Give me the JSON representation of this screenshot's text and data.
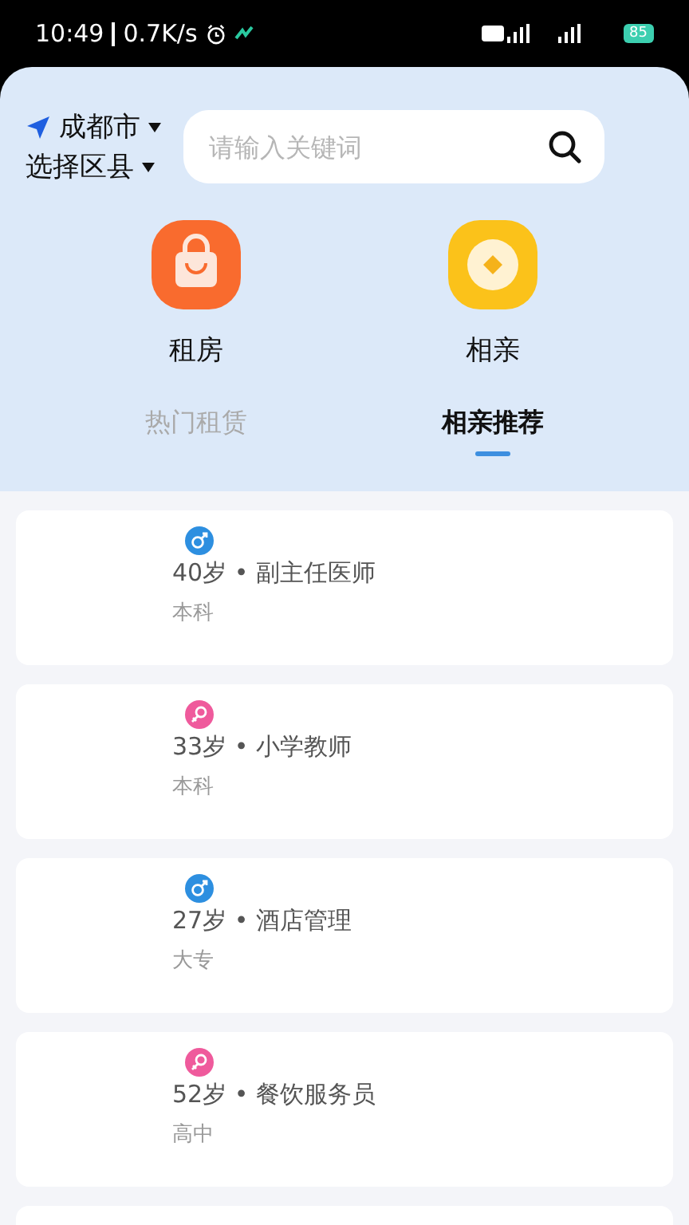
{
  "status_bar": {
    "time": "10:49",
    "speed": "0.7K/s",
    "battery": "85"
  },
  "location": {
    "city": "成都市",
    "district": "选择区县"
  },
  "search": {
    "placeholder": "请输入关键词"
  },
  "shortcuts": [
    {
      "label": "租房",
      "kind": "bag"
    },
    {
      "label": "相亲",
      "kind": "coin"
    }
  ],
  "tabs": [
    {
      "label": "热门租赁",
      "selected": false
    },
    {
      "label": "相亲推荐",
      "selected": true
    }
  ],
  "profiles": [
    {
      "kind": "male",
      "title": "40岁 • 副主任医师",
      "education": "本科"
    },
    {
      "kind": "female",
      "title": "33岁 • 小学教师",
      "education": "本科"
    },
    {
      "kind": "male",
      "title": "27岁 • 酒店管理",
      "education": "大专"
    },
    {
      "kind": "female",
      "title": "52岁 • 餐饮服务员",
      "education": "高中"
    }
  ]
}
